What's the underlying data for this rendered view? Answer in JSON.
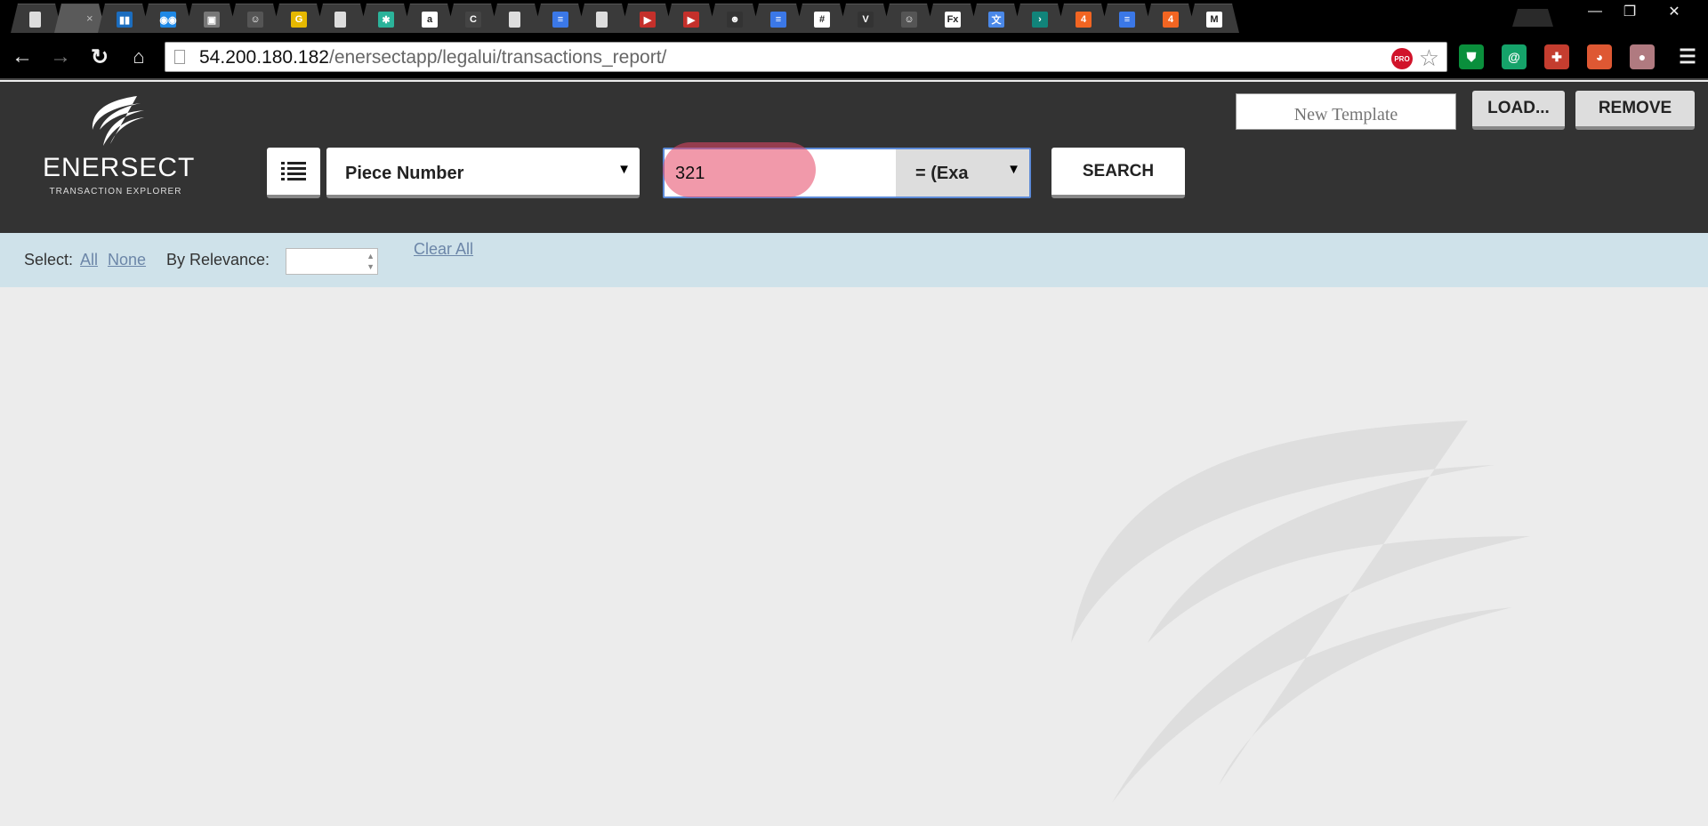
{
  "browser": {
    "tabs": [
      {
        "favicon": "page-icon",
        "color": "#444"
      },
      {
        "favicon": "loading-icon",
        "color": "#5a5a5a",
        "active": true
      },
      {
        "favicon": "trello-icon",
        "color": "#1b6dbf"
      },
      {
        "favicon": "gamepad-icon",
        "color": "#1e88e5"
      },
      {
        "favicon": "photo-icon",
        "color": "#777"
      },
      {
        "favicon": "monkey-icon",
        "color": "#555"
      },
      {
        "favicon": "g-icon",
        "color": "#e6b800"
      },
      {
        "favicon": "page-icon",
        "color": "#444"
      },
      {
        "favicon": "grid-icon",
        "color": "#2bb39a"
      },
      {
        "favicon": "amazon-icon",
        "color": "#fff"
      },
      {
        "favicon": "c-icon",
        "color": "#444"
      },
      {
        "favicon": "page-icon",
        "color": "#444"
      },
      {
        "favicon": "docs-icon",
        "color": "#3b78e7"
      },
      {
        "favicon": "page-icon",
        "color": "#444"
      },
      {
        "favicon": "youtube-icon",
        "color": "#c4302b"
      },
      {
        "favicon": "youtube-icon",
        "color": "#c4302b"
      },
      {
        "favicon": "face-icon",
        "color": "#333"
      },
      {
        "favicon": "docs-icon",
        "color": "#3b78e7"
      },
      {
        "favicon": "slack-icon",
        "color": "#fff"
      },
      {
        "favicon": "v-icon",
        "color": "#333"
      },
      {
        "favicon": "monkey-icon",
        "color": "#555"
      },
      {
        "favicon": "fedex-icon",
        "color": "#fff"
      },
      {
        "favicon": "translate-icon",
        "color": "#4a88e8"
      },
      {
        "favicon": "chevron-right-icon",
        "color": "#11847a"
      },
      {
        "favicon": "four-icon",
        "color": "#f26522"
      },
      {
        "favicon": "docs-icon",
        "color": "#3b78e7"
      },
      {
        "favicon": "four-icon",
        "color": "#f26522"
      },
      {
        "favicon": "gmail-icon",
        "color": "#fff"
      }
    ],
    "tab_glyphs": {
      "trello-icon": "▮▮",
      "four-icon": "4",
      "v-icon": "V",
      "g-icon": "G",
      "amazon-icon": "a",
      "c-icon": "C",
      "chevron-right-icon": "›",
      "youtube-icon": "▶",
      "gmail-icon": "M",
      "docs-icon": "≡",
      "page-icon": "",
      "loading-icon": "",
      "translate-icon": "文",
      "slack-icon": "#",
      "grid-icon": "✱",
      "fedex-icon": "Fx",
      "gamepad-icon": "◉◉",
      "monkey-icon": "☺",
      "face-icon": "☻",
      "photo-icon": "▣"
    },
    "window_controls": {
      "minimize": "—",
      "restore": "❐",
      "close": "✕"
    },
    "url_host": "54.200.180.182",
    "url_path": "/enersectapp/legalui/transactions_report/",
    "pro_badge": "PRO",
    "extensions": [
      {
        "name": "shield-extension-icon",
        "glyph": "⛊",
        "color": "#0a8f3c"
      },
      {
        "name": "grammarly-icon",
        "glyph": "@",
        "color": "#15a36a"
      },
      {
        "name": "plus-extension-icon",
        "glyph": "✚",
        "color": "#c43d2f"
      },
      {
        "name": "duck-extension-icon",
        "glyph": "◕",
        "color": "#de5833"
      },
      {
        "name": "brain-extension-icon",
        "glyph": "●",
        "color": "#b07a80"
      }
    ]
  },
  "app": {
    "logo_name": "ENERSECT",
    "logo_sub": "TRANSACTION EXPLORER",
    "field_select_value": "Piece Number",
    "search_value": "321",
    "match_select_value": "= (Exa",
    "search_label": "SEARCH",
    "template_placeholder": "New Template",
    "load_label": "LOAD...",
    "remove_label": "REMOVE",
    "filter": {
      "select_label": "Select:",
      "all_link": "All",
      "none_link": "None",
      "relevance_label": "By Relevance:",
      "clear_all": "Clear All"
    }
  }
}
